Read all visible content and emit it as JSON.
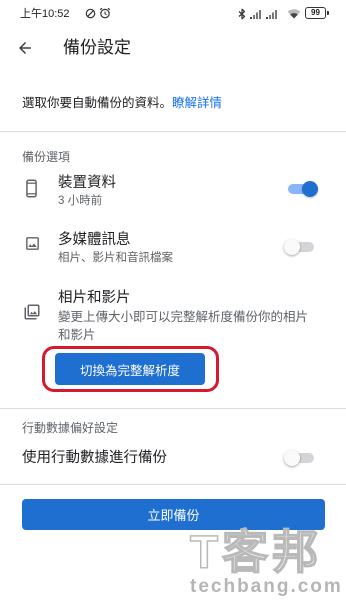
{
  "theme": {
    "accent": "#1f6fd0",
    "accent_light": "#8ab4f8",
    "link": "#1a73e8",
    "highlight": "#d7192b",
    "text": "#202124",
    "secondary_text": "#5f6368",
    "divider": "#dadce0"
  },
  "status_bar": {
    "time": "上午10:52",
    "left_icons": [
      "do-not-disturb-icon",
      "alarm-icon"
    ],
    "right_icons": [
      "bluetooth-icon",
      "signal-icon",
      "signal-icon",
      "wifi-icon",
      "battery-icon"
    ],
    "battery": "99"
  },
  "header": {
    "back_icon": "arrow-back-icon",
    "title": "備份設定"
  },
  "intro": {
    "text": "選取你要自動備份的資料。",
    "link": "瞭解詳情"
  },
  "backup_options": {
    "heading": "備份選項",
    "items": [
      {
        "icon": "phone-icon",
        "title": "裝置資料",
        "subtitle": "3 小時前",
        "toggle_on": true
      },
      {
        "icon": "image-icon",
        "title": "多媒體訊息",
        "subtitle": "相片、影片和音訊檔案",
        "toggle_on": false
      },
      {
        "icon": "photo-library-icon",
        "title": "相片和影片",
        "description": "變更上傳大小即可以完整解析度備份你的相片和影片",
        "button": "切換為完整解析度",
        "button_highlighted": true
      }
    ]
  },
  "mobile_data": {
    "heading": "行動數據偏好設定",
    "label": "使用行動數據進行備份",
    "toggle_on": false
  },
  "backup_now_button": "立即備份",
  "watermark": {
    "logo": "T客邦",
    "url": "techbang.com"
  }
}
